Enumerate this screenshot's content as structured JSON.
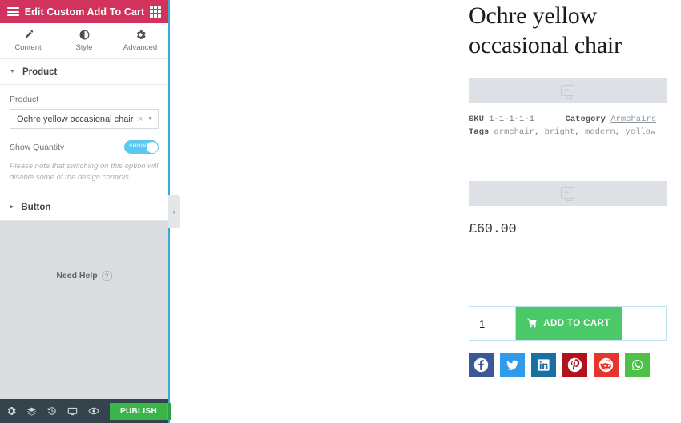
{
  "panel": {
    "header": {
      "title": "Edit Custom Add To Cart",
      "menu_icon": "hamburger-icon",
      "apps_icon": "grid-apps-icon"
    },
    "tabs": [
      {
        "label": "Content",
        "icon": "pencil-icon",
        "glyph": "✎",
        "active": true
      },
      {
        "label": "Style",
        "icon": "contrast-icon",
        "glyph": "◐",
        "active": false
      },
      {
        "label": "Advanced",
        "icon": "gear-icon",
        "glyph": "⚙",
        "active": false
      }
    ],
    "sections": [
      {
        "title": "Product",
        "expanded": true,
        "caret": "▼"
      },
      {
        "title": "Button",
        "expanded": false,
        "caret": "▶"
      }
    ],
    "product_section": {
      "field_label": "Product",
      "select_value": "Ochre yellow occasional chair",
      "clear_glyph": "×",
      "caret_glyph": "▼",
      "toggle_label": "Show Quantity",
      "toggle_state": "SHOW",
      "toggle_on": true,
      "note": "Please note that switching on this option will disable some of the design controls."
    },
    "need_help": {
      "label": "Need Help",
      "icon": "question-mark-icon",
      "glyph": "?"
    },
    "footer": {
      "icons": [
        {
          "name": "settings-gear-icon",
          "glyph": "⚙"
        },
        {
          "name": "navigator-layers-icon",
          "glyph": "☰"
        },
        {
          "name": "history-icon",
          "glyph": "↺"
        },
        {
          "name": "responsive-mode-icon",
          "glyph": "☐"
        },
        {
          "name": "preview-eye-icon",
          "glyph": "◉"
        }
      ],
      "publish_label": "PUBLISH",
      "publish_arrow_glyph": "▲"
    },
    "collapse_handle_glyph": "‹"
  },
  "canvas": {
    "product": {
      "title": "Ochre yellow occasional chair",
      "meta": {
        "sku_label": "SKU",
        "sku_value": "1-1-1-1-1",
        "category_label": "Category",
        "category_value": "Armchairs",
        "tags_label": "Tags",
        "tags": [
          "armchair",
          "bright",
          "modern",
          "yellow"
        ]
      },
      "price": "£60.00",
      "quantity": "1",
      "add_to_cart_label": "ADD TO CART",
      "cart_icon_glyph": "🛒",
      "placeholder_icon": "widget-placeholder-icon"
    },
    "socials": [
      {
        "name": "facebook",
        "label": "Facebook",
        "color": "#3b5998"
      },
      {
        "name": "twitter",
        "label": "Twitter",
        "color": "#2f9bea"
      },
      {
        "name": "linkedin",
        "label": "LinkedIn",
        "color": "#1a6fa3"
      },
      {
        "name": "pinterest",
        "label": "Pinterest",
        "color": "#b3121c"
      },
      {
        "name": "reddit",
        "label": "Reddit",
        "color": "#e8342a"
      },
      {
        "name": "whatsapp",
        "label": "WhatsApp",
        "color": "#4dc247"
      }
    ]
  },
  "colors": {
    "header_pink": "#d2335c",
    "accent_blue": "#3ba9d6",
    "publish_green": "#39b54a",
    "cart_green": "#4bc867",
    "toggle_blue": "#5bc8ef"
  }
}
